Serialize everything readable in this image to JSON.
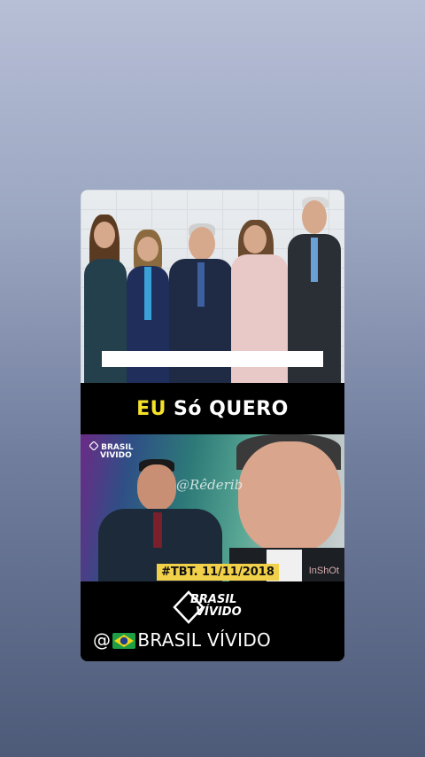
{
  "colors": {
    "background_top": "#b7bfd6",
    "background_bottom": "#4d5a78",
    "card": "#000000",
    "accent_yellow": "#f5e02a",
    "tag_yellow": "#f2d14a"
  },
  "title": {
    "highlight": "EU",
    "rest": "Só QUERO"
  },
  "photo2": {
    "logo_line1": "BRASIL",
    "logo_line2": "VIVIDO",
    "watermark": "@Rêderib",
    "tag": "#TBT.  11/11/2018",
    "app_mark": "InShOt"
  },
  "footer": {
    "logo_line1": "BRASIL",
    "logo_line2": "VÍVIDO",
    "handle_prefix": "@",
    "flag_icon": "brazil-flag-icon",
    "handle": "BRASIL VÍVIDO"
  }
}
